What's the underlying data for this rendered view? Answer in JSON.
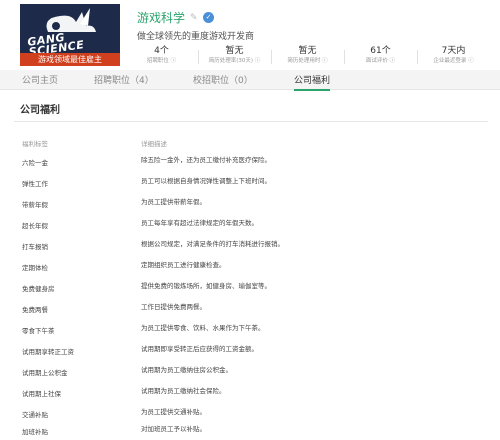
{
  "company": {
    "logo_text_line1": "GANG",
    "logo_text_line2": "SCIENCE",
    "logo_banner": "游戏领域最佳雇主",
    "name": "游戏科学",
    "slogan": "做全球领先的重度游戏开发商"
  },
  "stats": [
    {
      "value": "4个",
      "label": "招聘职位 ⓘ"
    },
    {
      "value": "暂无",
      "label": "简历处理率(30天) ⓘ"
    },
    {
      "value": "暂无",
      "label": "简历处理用时 ⓘ"
    },
    {
      "value": "61个",
      "label": "面试评价 ⓘ"
    },
    {
      "value": "7天内",
      "label": "企业最近登录 ⓘ"
    }
  ],
  "tabs": {
    "home": "公司主页",
    "jobs": "招聘职位（4）",
    "campus": "校招职位（0）",
    "benefits": "公司福利"
  },
  "benefits": {
    "title": "公司福利",
    "col_name": "福利标签",
    "col_desc": "详细描述",
    "items": [
      {
        "name": "六险一金",
        "desc": "除五险一金外，还为员工缴付补充医疗保险。"
      },
      {
        "name": "弹性工作",
        "desc": "员工可以根据自身情况弹性调整上下班时间。"
      },
      {
        "name": "带薪年假",
        "desc": "为员工提供带薪年假。"
      },
      {
        "name": "超长年假",
        "desc": "员工每年享有超过法律规定的年假天数。"
      },
      {
        "name": "打车报销",
        "desc": "根据公司规定，对满足条件的打车消耗进行报销。"
      },
      {
        "name": "定期体检",
        "desc": "定期组织员工进行健康检查。"
      },
      {
        "name": "免费健身房",
        "desc": "提供免费的锻炼场所，如健身房、瑜伽室等。"
      },
      {
        "name": "免费两餐",
        "desc": "工作日提供免费两餐。"
      },
      {
        "name": "零食下午茶",
        "desc": "为员工提供零食、饮料、水果作为下午茶。"
      },
      {
        "name": "试用期享转正工资",
        "desc": "试用期即享受转正后应获得的工资金额。"
      },
      {
        "name": "试用期上公积金",
        "desc": "试用期为员工缴纳住房公积金。"
      },
      {
        "name": "试用期上社保",
        "desc": "试用期为员工缴纳社会保险。"
      },
      {
        "name": "交通补贴",
        "desc": "为员工提供交通补贴。"
      },
      {
        "name": "加班补贴",
        "desc": "对加班员工予以补贴。"
      }
    ]
  },
  "colors": {
    "accent": "#2ba36d",
    "logo_bg": "#1d2a4a",
    "banner": "#d0401e"
  }
}
